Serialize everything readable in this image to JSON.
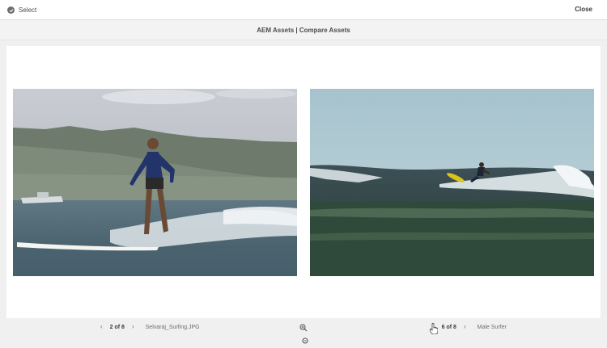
{
  "header": {
    "select_label": "Select",
    "close_label": "Close"
  },
  "title": "AEM Assets | Compare Assets",
  "compare": {
    "left": {
      "position": "2 of 8",
      "filename": "Selvaraj_Surfing.JPG"
    },
    "right": {
      "position": "6 of 8",
      "filename": "Male Surfer"
    }
  },
  "icons": {
    "prev": "chevron-left-icon",
    "next": "chevron-right-icon",
    "zoom_in": "zoom-in-icon",
    "zoom_out": "zoom-out-icon",
    "select": "check-circle-icon"
  },
  "colors": {
    "background": "#f0f0f0",
    "panel": "#ffffff",
    "text": "#4b4b4b"
  }
}
